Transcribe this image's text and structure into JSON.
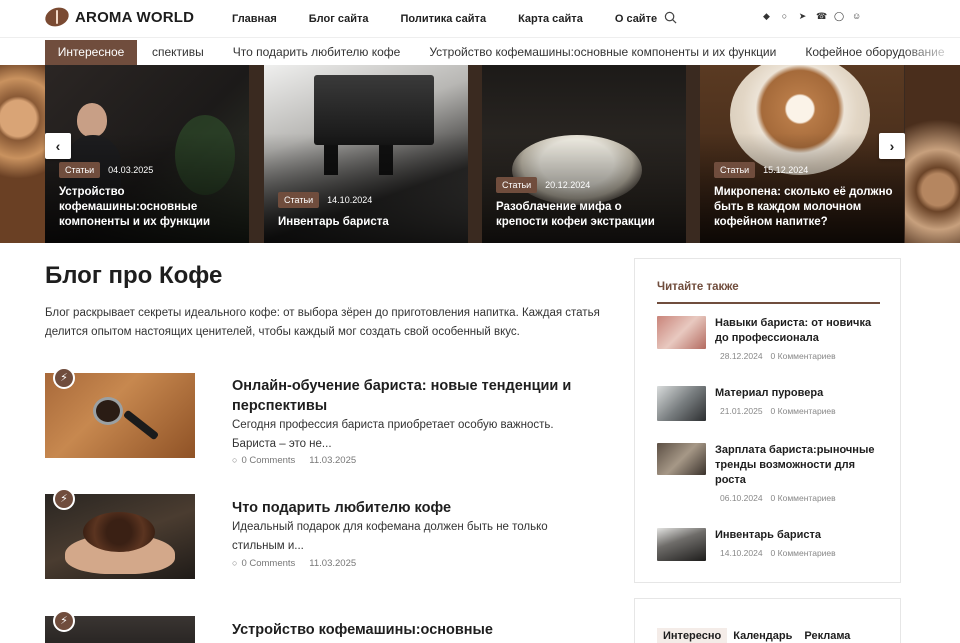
{
  "header": {
    "logo": "AROMA WORLD",
    "nav": [
      "Главная",
      "Блог сайта",
      "Политика сайта",
      "Карта сайта",
      "О сайте"
    ],
    "social_icons": [
      "vk-icon",
      "ok-icon",
      "telegram-icon",
      "viber-icon",
      "whatsapp-icon",
      "community-icon"
    ]
  },
  "ticker": {
    "label": "Интересное",
    "items": [
      "спективы",
      "Что подарить любителю кофе",
      "Устройство кофемашины:основные компоненты и их функции",
      "Кофейное оборудование"
    ]
  },
  "slider": {
    "slides": [
      {
        "badge": "Статьи",
        "date": "04.03.2025",
        "title": "Устройство кофемашины:основные компоненты и их функции"
      },
      {
        "badge": "Статьи",
        "date": "14.10.2024",
        "title": "Инвентарь бариста"
      },
      {
        "badge": "Статьи",
        "date": "20.12.2024",
        "title": "Разоблачение мифа о крепости кофеи экстракции"
      },
      {
        "badge": "Статьи",
        "date": "15.12.2024",
        "title": "Микропена: сколько её должно быть в каждом молочном кофейном напитке?"
      }
    ],
    "prev": "‹",
    "next": "›"
  },
  "main": {
    "title": "Блог про Кофе",
    "description": "Блог раскрывает секреты идеального кофе: от выбора зёрен до приготовления напитка. Каждая статья делится опытом настоящих ценителей, чтобы каждый мог создать свой особенный вкус.",
    "posts": [
      {
        "title": "Онлайн-обучение бариста: новые тенденции и перспективы",
        "excerpt": "Сегодня профессия бариста приобретает особую важность. Бариста – это не...",
        "comments": "0 Comments",
        "date": "11.03.2025"
      },
      {
        "title": "Что подарить любителю кофе",
        "excerpt": "Идеальный подарок для кофемана должен быть не только стильным и...",
        "comments": "0 Comments",
        "date": "11.03.2025"
      },
      {
        "title": "Устройство кофемашины:основные",
        "excerpt": "",
        "comments": "",
        "date": ""
      }
    ]
  },
  "sidebar": {
    "title": "Читайте также",
    "items": [
      {
        "title": "Навыки бариста: от новичка до профессионала",
        "date": "28.12.2024",
        "comments": "0 Комментариев"
      },
      {
        "title": "Материал пуровера",
        "date": "21.01.2025",
        "comments": "0 Комментариев"
      },
      {
        "title": "Зарплата бариста:рыночные тренды возможности для роста",
        "date": "06.10.2024",
        "comments": "0 Комментариев"
      },
      {
        "title": "Инвентарь бариста",
        "date": "14.10.2024",
        "comments": "0 Комментариев"
      }
    ]
  },
  "sidebar_tabs": [
    "Интересно",
    "Календарь",
    "Реклама"
  ]
}
